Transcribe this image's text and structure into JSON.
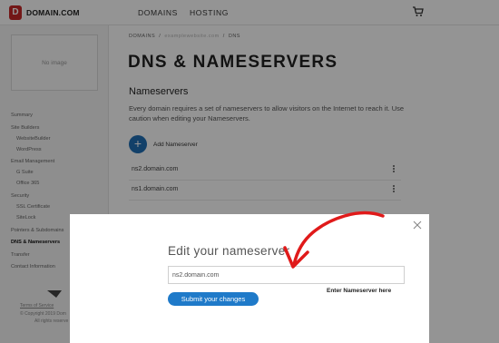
{
  "header": {
    "logo_letter": "D",
    "logo_text": "DOMAIN.COM",
    "nav": [
      "DOMAINS",
      "HOSTING"
    ],
    "cart_icon": "cart-icon"
  },
  "sidebar": {
    "thumbnail_text": "No image",
    "items": [
      {
        "label": "Summary",
        "sub": false
      },
      {
        "label": "Site Builders",
        "sub": false
      },
      {
        "label": "WebsiteBuilder",
        "sub": true
      },
      {
        "label": "WordPress",
        "sub": true
      },
      {
        "label": "Email Management",
        "sub": false
      },
      {
        "label": "G Suite",
        "sub": true
      },
      {
        "label": "Office 365",
        "sub": true
      },
      {
        "label": "Security",
        "sub": false
      },
      {
        "label": "SSL Certificate",
        "sub": true
      },
      {
        "label": "SiteLock",
        "sub": true
      },
      {
        "label": "Pointers & Subdomains",
        "sub": false
      },
      {
        "label": "DNS & Nameservers",
        "sub": false,
        "active": true
      },
      {
        "label": "Transfer",
        "sub": false
      },
      {
        "label": "Contact Information",
        "sub": false
      }
    ],
    "footer": {
      "terms": "Terms of Service",
      "copyright": "© Copyright 2019 Dom",
      "rights": "All rights reserve"
    }
  },
  "breadcrumb": {
    "root": "DOMAINS",
    "domain": "examplewebsite.com",
    "current": "DNS"
  },
  "main": {
    "title": "DNS & NAMESERVERS",
    "section_title": "Nameservers",
    "description": "Every domain requires a set of nameservers to allow visitors on the Internet to reach it. Use caution when editing your Nameservers.",
    "add_label": "Add Nameserver",
    "nameservers": [
      "ns2.domain.com",
      "ns1.domain.com"
    ]
  },
  "modal": {
    "title": "Edit your nameserver",
    "input_value": "ns2.domain.com",
    "submit_label": "Submit your changes",
    "annotation": "Enter Nameserver here"
  },
  "colors": {
    "brand_red": "#c62828",
    "accent_blue": "#1f6fb5",
    "annotation_arrow": "#e01a1a"
  }
}
